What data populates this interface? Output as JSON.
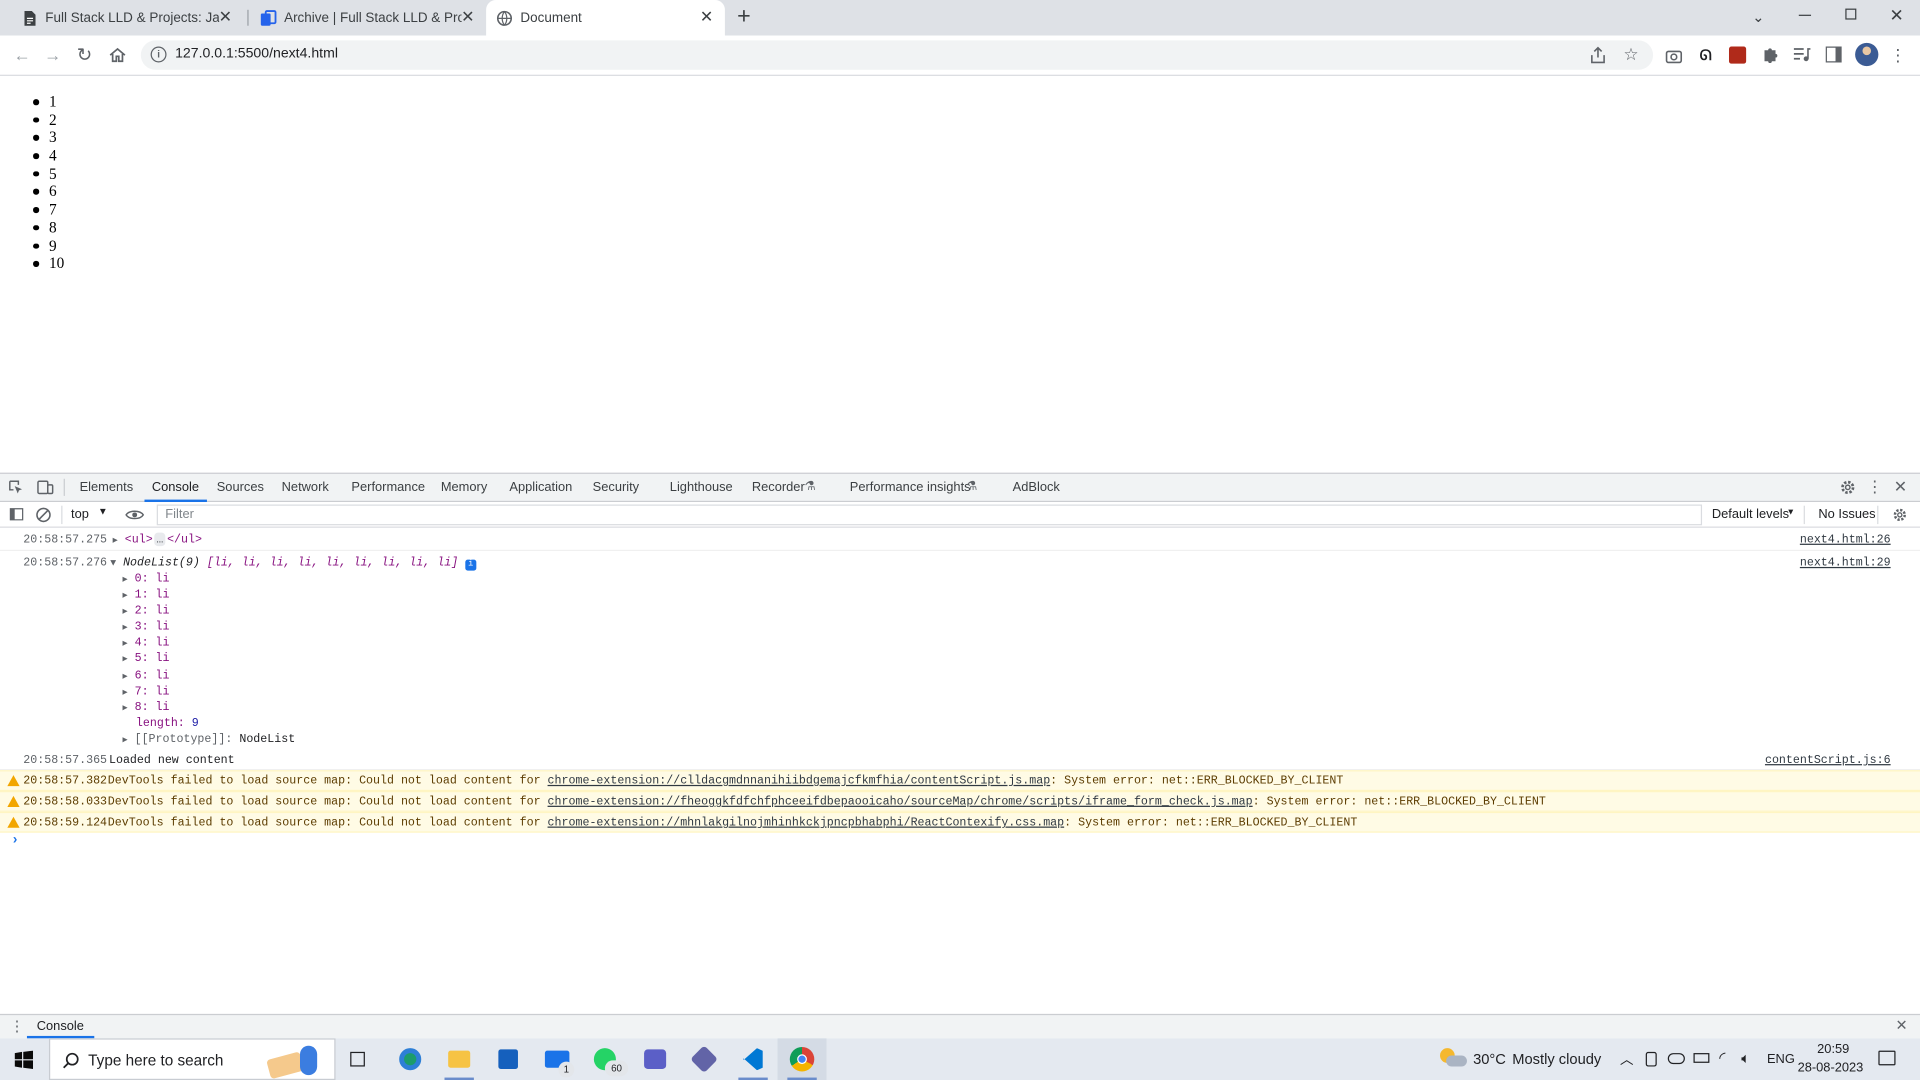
{
  "browser": {
    "tabs": [
      {
        "label": "Full Stack LLD & Projects: JavaScr",
        "active": false
      },
      {
        "label": "Archive | Full Stack LLD & Project",
        "active": false
      },
      {
        "label": "Document",
        "active": true
      }
    ],
    "new_tab": "+",
    "url": "127.0.0.1:5500/next4.html"
  },
  "page": {
    "items": [
      "1",
      "2",
      "3",
      "4",
      "5",
      "6",
      "7",
      "8",
      "9",
      "10"
    ]
  },
  "devtools": {
    "tabs": [
      "Elements",
      "Console",
      "Sources",
      "Network",
      "Performance",
      "Memory",
      "Application",
      "Security",
      "Lighthouse",
      "Recorder",
      "Performance insights",
      "AdBlock"
    ],
    "active_tab": "Console",
    "context": "top",
    "filter_placeholder": "Filter",
    "levels": "Default levels",
    "issues": "No Issues",
    "log": {
      "r1": {
        "time": "20:58:57.275",
        "text": "<ul>",
        "ell": "…",
        "close": "</ul>",
        "src": "next4.html:26"
      },
      "r2": {
        "time": "20:58:57.276",
        "head": "NodeList(9)",
        "summary": "[li, li, li, li, li, li, li, li, li]",
        "src": "next4.html:29"
      },
      "children": [
        {
          "key": "0:",
          "val": "li"
        },
        {
          "key": "1:",
          "val": "li"
        },
        {
          "key": "2:",
          "val": "li"
        },
        {
          "key": "3:",
          "val": "li"
        },
        {
          "key": "4:",
          "val": "li"
        },
        {
          "key": "5:",
          "val": "li"
        },
        {
          "key": "6:",
          "val": "li"
        },
        {
          "key": "7:",
          "val": "li"
        },
        {
          "key": "8:",
          "val": "li"
        }
      ],
      "length_key": "length:",
      "length_val": "9",
      "proto_key": "[[Prototype]]:",
      "proto_val": "NodeList",
      "r3": {
        "time": "20:58:57.365",
        "text": "Loaded new content",
        "src": "contentScript.js:6"
      },
      "warnings": [
        {
          "time": "20:58:57.382",
          "pre": "DevTools failed to load source map: Could not load content for",
          "link": "chrome-extension://clldacgmdnnanihiibdgemajcfkmfhia/contentScript.js.map",
          "post": ": System error: net::ERR_BLOCKED_BY_CLIENT"
        },
        {
          "time": "20:58:58.033",
          "pre": "DevTools failed to load source map: Could not load content for",
          "link": "chrome-extension://fheoggkfdfchfphceeifdbepaooicaho/sourceMap/chrome/scripts/iframe_form_check.js.map",
          "post": ": System error: net::ERR_BLOCKED_BY_CLIENT"
        },
        {
          "time": "20:58:59.124",
          "pre": "DevTools failed to load source map: Could not load content for",
          "link": "chrome-extension://mhnlakgilnojmhinhkckjpncpbhabphi/ReactContexify.css.map",
          "post": ": System error: net::ERR_BLOCKED_BY_CLIENT"
        }
      ],
      "prompt": "›"
    },
    "drawer_tab": "Console"
  },
  "taskbar": {
    "search_placeholder": "Type here to search",
    "weather": {
      "temp": "30°C",
      "desc": "Mostly cloudy"
    },
    "lang": "ENG",
    "time": "20:59",
    "date": "28-08-2023",
    "mail_badge": "1",
    "whatsapp_badge": "60"
  },
  "colors": {
    "accent": "#1a73e8",
    "tabstrip": "#dee1e6",
    "warning_bg": "#fffbe5"
  }
}
